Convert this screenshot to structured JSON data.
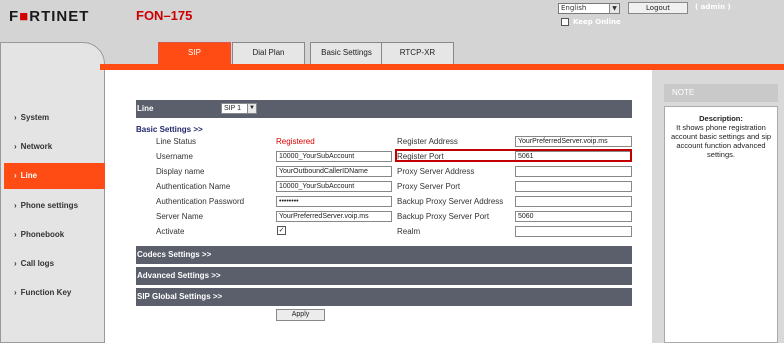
{
  "header": {
    "brand": "F",
    "brand_rest": "RTINET",
    "model": "FON–175",
    "language_selected": "English",
    "logout_label": "Logout",
    "user": "( admin )",
    "keep_online_label": "Keep Online"
  },
  "tabs": [
    {
      "label": "SIP",
      "active": true
    },
    {
      "label": "Dial Plan",
      "active": false
    },
    {
      "label": "Basic Settings",
      "active": false
    },
    {
      "label": "RTCP-XR",
      "active": false
    }
  ],
  "sidebar": {
    "items": [
      {
        "label": "System"
      },
      {
        "label": "Network"
      },
      {
        "label": "Line",
        "active": true
      },
      {
        "label": "Phone settings"
      },
      {
        "label": "Phonebook"
      },
      {
        "label": "Call logs"
      },
      {
        "label": "Function Key"
      }
    ],
    "chevron": "›"
  },
  "main": {
    "line_label": "Line",
    "line_select": "SIP 1",
    "basic_heading": "Basic Settings >>",
    "left_fields": [
      {
        "label": "Line Status",
        "value": "Registered"
      },
      {
        "label": "Username",
        "value": "10000_YourSubAccount"
      },
      {
        "label": "Display name",
        "value": "YourOutboundCallerIDName"
      },
      {
        "label": "Authentication Name",
        "value": "10000_YourSubAccount"
      },
      {
        "label": "Authentication Password",
        "value": "••••••••"
      },
      {
        "label": "Server Name",
        "value": "YourPreferredServer.voip.ms"
      },
      {
        "label": "Activate",
        "value": "✓"
      }
    ],
    "right_fields": [
      {
        "label": "Register Address",
        "value": "YourPreferredServer.voip.ms"
      },
      {
        "label": "Register Port",
        "value": "5061"
      },
      {
        "label": "Proxy Server Address",
        "value": ""
      },
      {
        "label": "Proxy Server Port",
        "value": ""
      },
      {
        "label": "Backup Proxy Server Address",
        "value": ""
      },
      {
        "label": "Backup Proxy Server Port",
        "value": "5060"
      },
      {
        "label": "Realm",
        "value": ""
      }
    ],
    "sections": [
      "Codecs Settings >>",
      "Advanced Settings >>",
      "SIP Global Settings >>"
    ],
    "apply_label": "Apply"
  },
  "note": {
    "header": "NOTE",
    "title": "Description:",
    "text": "It shows phone registration account basic settings and sip account function advanced settings."
  },
  "colors": {
    "accent": "#ff4b14",
    "section_bar": "#5a5f6b",
    "status_registered": "#dd0000",
    "highlight": "#c20000"
  }
}
